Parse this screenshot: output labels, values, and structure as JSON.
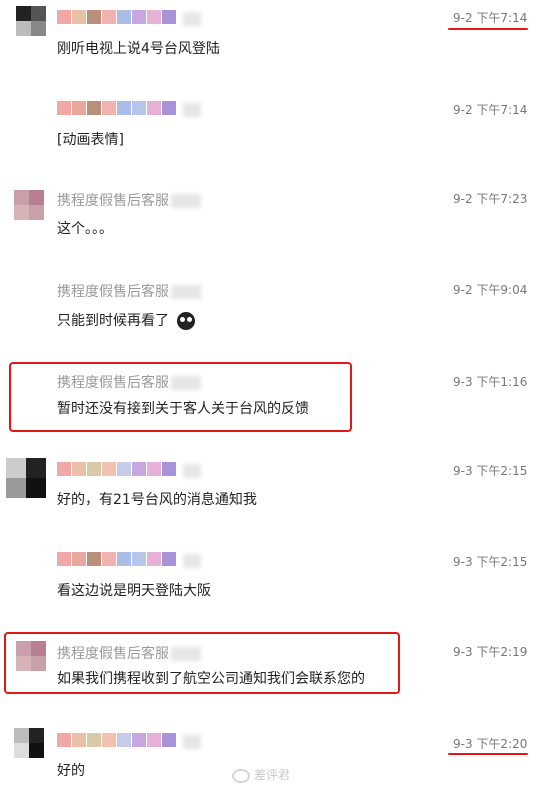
{
  "service_name": "携程度假售后客服",
  "messages": [
    {
      "sender": "customer",
      "time": "9-2 下午7:14",
      "text": "刚听电视上说4号台风登陆"
    },
    {
      "sender": "customer",
      "time": "9-2 下午7:14",
      "text": "[动画表情]"
    },
    {
      "sender": "service",
      "time": "9-2 下午7:23",
      "text": "这个。。。"
    },
    {
      "sender": "service",
      "time": "9-2 下午9:04",
      "text": "只能到时候再看了"
    },
    {
      "sender": "service",
      "time": "9-3 下午1:16",
      "text": "暂时还没有接到关于客人关于台风的反馈"
    },
    {
      "sender": "customer",
      "time": "9-3 下午2:15",
      "text": "好的，有21号台风的消息通知我"
    },
    {
      "sender": "customer",
      "time": "9-3 下午2:15",
      "text": "看这边说是明天登陆大阪"
    },
    {
      "sender": "service",
      "time": "9-3 下午2:19",
      "text": "如果我们携程收到了航空公司通知我们会联系您的"
    },
    {
      "sender": "customer",
      "time": "9-3 下午2:20",
      "text": "好的"
    }
  ],
  "emoji_icon": "owl-face-icon",
  "watermark": {
    "icon": "weibo-icon",
    "text": "差评君"
  },
  "colors": {
    "highlight": "#e01818",
    "name_gray": "#9a9a9a",
    "time_gray": "#777777"
  }
}
